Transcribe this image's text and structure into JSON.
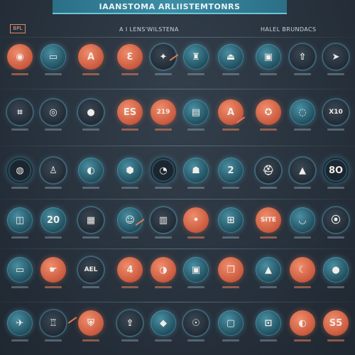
{
  "header": {
    "title": "IAANSTOMA ARLIISTEMTONRS",
    "tag": "BPL",
    "sub_left": "A I LENS'WILSTENA",
    "sub_right": "HALEL BRUNDACS"
  },
  "rows": [
    {
      "icons": [
        {
          "name": "globe-icon",
          "style": "orange",
          "glyph": "◉"
        },
        {
          "name": "monitor-icon",
          "style": "teal",
          "glyph": "▭"
        },
        {
          "name": "letter-a-icon",
          "style": "orange",
          "glyph": "A"
        },
        {
          "name": "screen-icon",
          "style": "orange",
          "glyph": "Ɛ"
        },
        {
          "name": "spark-icon",
          "style": "dark",
          "glyph": "✦"
        },
        {
          "name": "robot-icon",
          "style": "teal",
          "glyph": "♜"
        },
        {
          "name": "flask-icon",
          "style": "teal",
          "glyph": "⏏"
        },
        {
          "name": "device-icon",
          "style": "teal",
          "glyph": "▣"
        },
        {
          "name": "arrow-up-icon",
          "style": "dark",
          "glyph": "⇧"
        },
        {
          "name": "compass-icon",
          "style": "dark",
          "glyph": "➤"
        }
      ]
    },
    {
      "icons": [
        {
          "name": "gauge-icon",
          "style": "dark",
          "glyph": "⌗"
        },
        {
          "name": "eye-icon",
          "style": "dark",
          "glyph": "◎"
        },
        {
          "name": "lens-icon",
          "style": "dark",
          "glyph": "●"
        },
        {
          "name": "chip-icon",
          "style": "orange",
          "glyph": "ES"
        },
        {
          "name": "counter-icon",
          "style": "orange",
          "glyph": "219"
        },
        {
          "name": "display-icon",
          "style": "teal",
          "glyph": "▤"
        },
        {
          "name": "rune-icon",
          "style": "orange",
          "glyph": "A"
        },
        {
          "name": "radish-icon",
          "style": "orange",
          "glyph": "✪"
        },
        {
          "name": "orbit-icon",
          "style": "teal",
          "glyph": "◌"
        },
        {
          "name": "number-icon",
          "style": "dark",
          "glyph": "X10"
        }
      ]
    },
    {
      "icons": [
        {
          "name": "radar-icon",
          "style": "ring",
          "glyph": "◍"
        },
        {
          "name": "figure-icon",
          "style": "dark",
          "glyph": "♙"
        },
        {
          "name": "planet-icon",
          "style": "teal",
          "glyph": "◐"
        },
        {
          "name": "hex-icon",
          "style": "teal",
          "glyph": "⬢"
        },
        {
          "name": "dial-icon",
          "style": "ring",
          "glyph": "◔"
        },
        {
          "name": "bot-icon",
          "style": "teal",
          "glyph": "☗"
        },
        {
          "name": "two-icon",
          "style": "teal",
          "glyph": "2"
        },
        {
          "name": "helmet-icon",
          "style": "dark",
          "glyph": "⛑"
        },
        {
          "name": "flame-icon",
          "style": "dark",
          "glyph": "▲"
        },
        {
          "name": "score-icon",
          "style": "ring",
          "glyph": "8O"
        }
      ]
    },
    {
      "icons": [
        {
          "name": "drum-icon",
          "style": "teal",
          "glyph": "◫"
        },
        {
          "name": "sphere-icon",
          "style": "teal",
          "glyph": "20"
        },
        {
          "name": "panel-icon",
          "style": "dark",
          "glyph": "▦"
        },
        {
          "name": "person-icon",
          "style": "teal",
          "glyph": "☺"
        },
        {
          "name": "book-icon",
          "style": "dark",
          "glyph": "▥"
        },
        {
          "name": "dot-icon",
          "style": "orange",
          "glyph": "•"
        },
        {
          "name": "calc-icon",
          "style": "teal",
          "glyph": "⊞"
        },
        {
          "name": "badge-icon",
          "style": "orange",
          "glyph": "SITE"
        },
        {
          "name": "cup-icon",
          "style": "teal",
          "glyph": "◡"
        },
        {
          "name": "sensor-icon",
          "style": "dark",
          "glyph": "⦿"
        }
      ]
    },
    {
      "icons": [
        {
          "name": "tablet-icon",
          "style": "teal",
          "glyph": "▭"
        },
        {
          "name": "hand-icon",
          "style": "orange",
          "glyph": "☛"
        },
        {
          "name": "label-icon",
          "style": "dark",
          "glyph": "AEL"
        },
        {
          "name": "four-icon",
          "style": "orange",
          "glyph": "4"
        },
        {
          "name": "pulse-icon",
          "style": "orange",
          "glyph": "◑"
        },
        {
          "name": "cube-icon",
          "style": "teal",
          "glyph": "▣"
        },
        {
          "name": "box-icon",
          "style": "orange",
          "glyph": "❒"
        },
        {
          "name": "mountain-icon",
          "style": "teal",
          "glyph": "▲"
        },
        {
          "name": "moon-icon",
          "style": "orange",
          "glyph": "☾"
        },
        {
          "name": "ball-icon",
          "style": "teal",
          "glyph": "●"
        }
      ]
    },
    {
      "icons": [
        {
          "name": "bird-icon",
          "style": "teal",
          "glyph": "✈"
        },
        {
          "name": "castle-icon",
          "style": "dark",
          "glyph": "♖"
        },
        {
          "name": "shield-icon",
          "style": "orange",
          "glyph": "⛨"
        },
        {
          "name": "rocket-icon",
          "style": "dark",
          "glyph": "⇪"
        },
        {
          "name": "crystal-icon",
          "style": "teal",
          "glyph": "◆"
        },
        {
          "name": "lamp-icon",
          "style": "dark",
          "glyph": "☉"
        },
        {
          "name": "screen-box-icon",
          "style": "teal",
          "glyph": "▢"
        },
        {
          "name": "jar-icon",
          "style": "teal",
          "glyph": "⊡"
        },
        {
          "name": "fish-icon",
          "style": "orange",
          "glyph": "◐"
        },
        {
          "name": "grade-icon",
          "style": "orange",
          "glyph": "S5"
        }
      ]
    }
  ]
}
